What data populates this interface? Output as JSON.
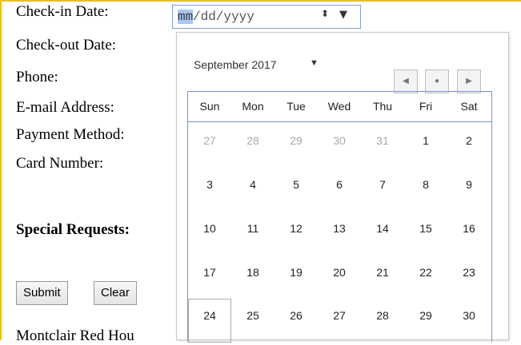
{
  "form": {
    "checkin_label": "Check-in Date:",
    "checkout_label": "Check-out Date:",
    "phone_label": "Phone:",
    "email_label": "E-mail Address:",
    "payment_label": "Payment Method:",
    "card_label": "Card Number:",
    "special_label": "Special Requests:",
    "submit_label": "Submit",
    "clear_label": "Clear",
    "cutoff_text": "Montclair Red Hou"
  },
  "date_input": {
    "month_segment": "mm",
    "rest": "/dd/yyyy",
    "spin_icon": "⬍",
    "dropdown_icon": "▼"
  },
  "calendar": {
    "month_title": "September 2017",
    "caret": "▼",
    "prev_icon": "◀",
    "today_icon": "●",
    "next_icon": "▶",
    "weekdays": [
      "Sun",
      "Mon",
      "Tue",
      "Wed",
      "Thu",
      "Fri",
      "Sat"
    ],
    "weeks": [
      [
        "27",
        "28",
        "29",
        "30",
        "31",
        "1",
        "2"
      ],
      [
        "3",
        "4",
        "5",
        "6",
        "7",
        "8",
        "9"
      ],
      [
        "10",
        "11",
        "12",
        "13",
        "14",
        "15",
        "16"
      ],
      [
        "17",
        "18",
        "19",
        "20",
        "21",
        "22",
        "23"
      ],
      [
        "24",
        "25",
        "26",
        "27",
        "28",
        "29",
        "30"
      ]
    ],
    "muted": [
      [
        true,
        true,
        true,
        true,
        true,
        false,
        false
      ],
      [
        false,
        false,
        false,
        false,
        false,
        false,
        false
      ],
      [
        false,
        false,
        false,
        false,
        false,
        false,
        false
      ],
      [
        false,
        false,
        false,
        false,
        false,
        false,
        false
      ],
      [
        false,
        false,
        false,
        false,
        false,
        false,
        false
      ]
    ],
    "colors": {
      "border": "#6f96e0",
      "muted_text": "#a9a9a9",
      "highlight": "#aac7f0"
    }
  }
}
